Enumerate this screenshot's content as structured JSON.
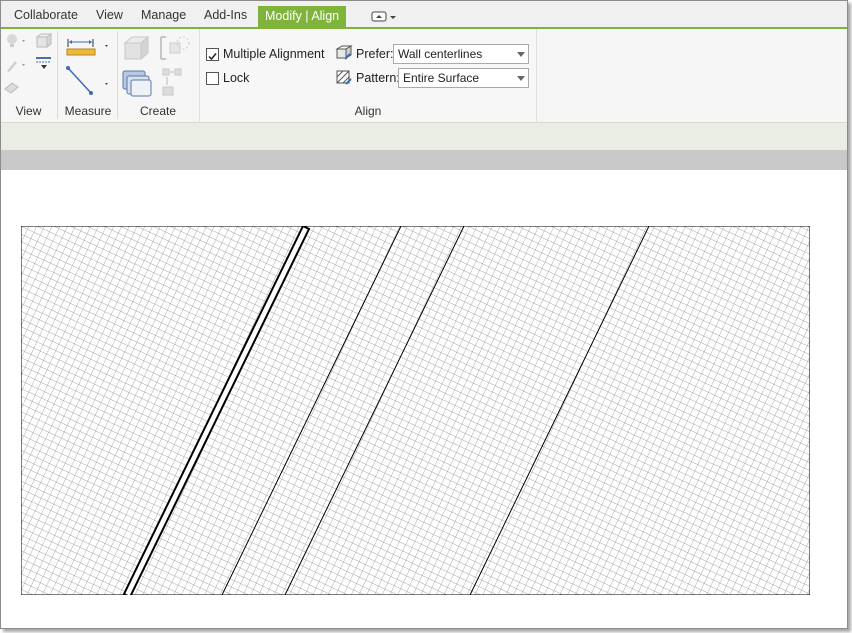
{
  "tabs": [
    {
      "label": "Collaborate"
    },
    {
      "label": "View"
    },
    {
      "label": "Manage"
    },
    {
      "label": "Add-Ins"
    },
    {
      "label": "Modify | Align"
    }
  ],
  "panels": {
    "view": {
      "title": "View"
    },
    "measure": {
      "title": "Measure"
    },
    "create": {
      "title": "Create"
    },
    "align": {
      "title": "Align"
    }
  },
  "options": {
    "multiple_alignment": {
      "label": "Multiple Alignment",
      "checked": true
    },
    "lock": {
      "label": "Lock",
      "checked": false
    },
    "prefer": {
      "label": "Prefer:",
      "value": "Wall centerlines"
    },
    "pattern": {
      "label": "Pattern:",
      "value": "Entire Surface"
    }
  },
  "colors": {
    "accent": "#7fb33c",
    "ribbon_bg": "#f5f6f5"
  }
}
